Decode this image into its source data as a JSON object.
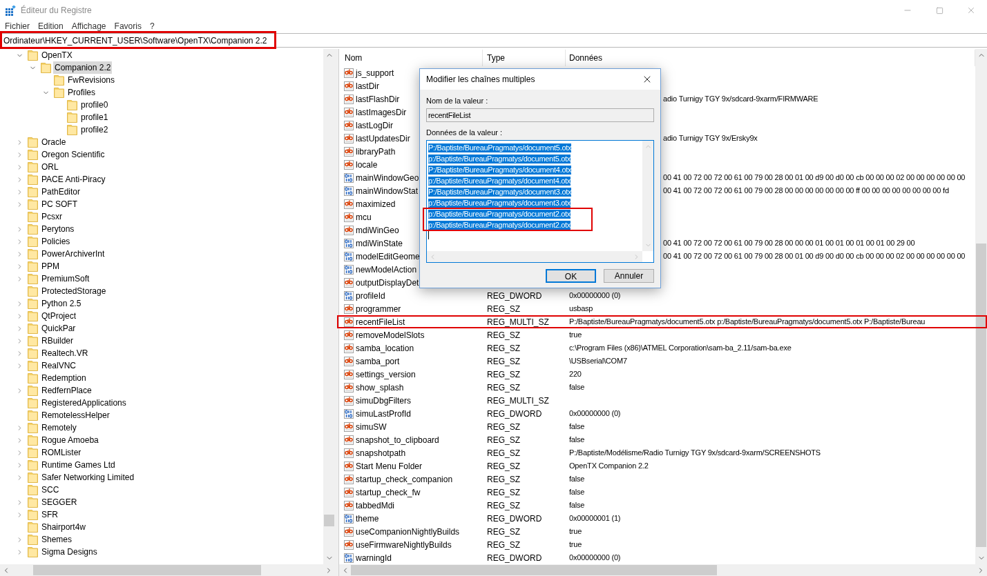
{
  "window": {
    "title": "Éditeur du Registre"
  },
  "menu": [
    "Fichier",
    "Edition",
    "Affichage",
    "Favoris",
    "?"
  ],
  "address_bar": {
    "value": "Ordinateur\\HKEY_CURRENT_USER\\Software\\OpenTX\\Companion 2.2"
  },
  "tree": [
    {
      "name": "OpenTX",
      "expanded": true,
      "selected": false,
      "children": [
        {
          "name": "Companion 2.2",
          "expanded": true,
          "selected": true,
          "children": [
            {
              "name": "FwRevisions",
              "selected": false
            },
            {
              "name": "Profiles",
              "expanded": true,
              "selected": false,
              "children": [
                {
                  "name": "profile0",
                  "selected": false
                },
                {
                  "name": "profile1",
                  "selected": false
                },
                {
                  "name": "profile2",
                  "selected": false
                }
              ]
            }
          ]
        }
      ]
    },
    {
      "name": "Oracle",
      "expanded": false,
      "selected": false
    },
    {
      "name": "Oregon Scientific",
      "expanded": false,
      "selected": false
    },
    {
      "name": "ORL",
      "expanded": false,
      "selected": false
    },
    {
      "name": "PACE Anti-Piracy",
      "expanded": false,
      "selected": false
    },
    {
      "name": "PathEditor",
      "expanded": false,
      "selected": false
    },
    {
      "name": "PC SOFT",
      "expanded": false,
      "selected": false
    },
    {
      "name": "Pcsxr",
      "selected": false
    },
    {
      "name": "Perytons",
      "expanded": false,
      "selected": false
    },
    {
      "name": "Policies",
      "expanded": false,
      "selected": false
    },
    {
      "name": "PowerArchiverInt",
      "expanded": false,
      "selected": false
    },
    {
      "name": "PPM",
      "expanded": false,
      "selected": false
    },
    {
      "name": "PremiumSoft",
      "expanded": false,
      "selected": false
    },
    {
      "name": "ProtectedStorage",
      "selected": false
    },
    {
      "name": "Python 2.5",
      "expanded": false,
      "selected": false
    },
    {
      "name": "QtProject",
      "expanded": false,
      "selected": false
    },
    {
      "name": "QuickPar",
      "expanded": false,
      "selected": false
    },
    {
      "name": "RBuilder",
      "expanded": false,
      "selected": false
    },
    {
      "name": "Realtech.VR",
      "expanded": false,
      "selected": false
    },
    {
      "name": "RealVNC",
      "expanded": false,
      "selected": false
    },
    {
      "name": "Redemption",
      "selected": false
    },
    {
      "name": "RedfernPlace",
      "expanded": false,
      "selected": false
    },
    {
      "name": "RegisteredApplications",
      "selected": false
    },
    {
      "name": "RemotelessHelper",
      "selected": false
    },
    {
      "name": "Remotely",
      "expanded": false,
      "selected": false
    },
    {
      "name": "Rogue Amoeba",
      "expanded": false,
      "selected": false
    },
    {
      "name": "ROMLister",
      "expanded": false,
      "selected": false
    },
    {
      "name": "Runtime Games Ltd",
      "expanded": false,
      "selected": false
    },
    {
      "name": "Safer Networking Limited",
      "expanded": false,
      "selected": false
    },
    {
      "name": "SCC",
      "selected": false
    },
    {
      "name": "SEGGER",
      "expanded": false,
      "selected": false
    },
    {
      "name": "SFR",
      "expanded": false,
      "selected": false
    },
    {
      "name": "Shairport4w",
      "selected": false
    },
    {
      "name": "Shemes",
      "expanded": false,
      "selected": false
    },
    {
      "name": "Sigma Designs",
      "expanded": false,
      "selected": false
    }
  ],
  "list": {
    "columns": [
      "Nom",
      "Type",
      "Données"
    ],
    "rows": [
      {
        "kind": "string",
        "name": "js_support"
      },
      {
        "kind": "string",
        "name": "lastDir"
      },
      {
        "kind": "string",
        "name": "lastFlashDir",
        "data": "adio Turnigy TGY 9x/sdcard-9xarm/FIRMWARE"
      },
      {
        "kind": "string",
        "name": "lastImagesDir"
      },
      {
        "kind": "string",
        "name": "lastLogDir"
      },
      {
        "kind": "string",
        "name": "lastUpdatesDir",
        "data": "adio Turnigy TGY 9x/Ersky9x"
      },
      {
        "kind": "string",
        "name": "libraryPath"
      },
      {
        "kind": "string",
        "name": "locale"
      },
      {
        "kind": "binary",
        "name": "mainWindowGeo",
        "data": "00 41 00 72 00 72 00 61 00 79 00 28 00 01 00 d9 00 d0 00 cb 00 00 00 02 00 00 00 00 00 00"
      },
      {
        "kind": "binary",
        "name": "mainWindowStat",
        "data": "00 41 00 72 00 72 00 61 00 79 00 28 00 00 00 00 00 00 00 ff 00 00 00 00 00 00 00 00 fd"
      },
      {
        "kind": "string",
        "name": "maximized"
      },
      {
        "kind": "string",
        "name": "mcu"
      },
      {
        "kind": "string",
        "name": "mdiWinGeo"
      },
      {
        "kind": "binary",
        "name": "mdiWinState",
        "data": "00 41 00 72 00 72 00 61 00 79 00 28 00 00 00 01 00 01 00 01 00 01 00 29 00"
      },
      {
        "kind": "binary",
        "name": "modelEditGeome",
        "data": "00 41 00 72 00 72 00 61 00 79 00 28 00 01 00 d9 00 d0 00 cb 00 00 00 02 00 00 00 00 00 00"
      },
      {
        "kind": "binary",
        "name": "newModelAction"
      },
      {
        "kind": "string",
        "name": "outputDisplayDet"
      },
      {
        "kind": "binary",
        "name": "profileId",
        "type": "REG_DWORD",
        "data": "0x00000000 (0)"
      },
      {
        "kind": "string",
        "name": "programmer",
        "type": "REG_SZ",
        "data": "usbasp"
      },
      {
        "kind": "string",
        "name": "recentFileList",
        "type": "REG_MULTI_SZ",
        "data": "P:/Baptiste/BureauPragmatys/document5.otx p:/Baptiste/BureauPragmatys/document5.otx P:/Baptiste/Bureau"
      },
      {
        "kind": "string",
        "name": "removeModelSlots",
        "type": "REG_SZ",
        "data": "true"
      },
      {
        "kind": "string",
        "name": "samba_location",
        "type": "REG_SZ",
        "data": "c:\\Program Files (x86)\\ATMEL Corporation\\sam-ba_2.11/sam-ba.exe"
      },
      {
        "kind": "string",
        "name": "samba_port",
        "type": "REG_SZ",
        "data": "\\USBserial\\COM7"
      },
      {
        "kind": "string",
        "name": "settings_version",
        "type": "REG_SZ",
        "data": "220"
      },
      {
        "kind": "string",
        "name": "show_splash",
        "type": "REG_SZ",
        "data": "false"
      },
      {
        "kind": "string",
        "name": "simuDbgFilters",
        "type": "REG_MULTI_SZ"
      },
      {
        "kind": "binary",
        "name": "simuLastProfId",
        "type": "REG_DWORD",
        "data": "0x00000000 (0)"
      },
      {
        "kind": "string",
        "name": "simuSW",
        "type": "REG_SZ",
        "data": "false"
      },
      {
        "kind": "string",
        "name": "snapshot_to_clipboard",
        "type": "REG_SZ",
        "data": "false"
      },
      {
        "kind": "string",
        "name": "snapshotpath",
        "type": "REG_SZ",
        "data": "P:/Baptiste/Modélisme/Radio Turnigy TGY 9x/sdcard-9xarm/SCREENSHOTS"
      },
      {
        "kind": "string",
        "name": "Start Menu Folder",
        "type": "REG_SZ",
        "data": "OpenTX Companion 2.2"
      },
      {
        "kind": "string",
        "name": "startup_check_companion",
        "type": "REG_SZ",
        "data": "false"
      },
      {
        "kind": "string",
        "name": "startup_check_fw",
        "type": "REG_SZ",
        "data": "false"
      },
      {
        "kind": "string",
        "name": "tabbedMdi",
        "type": "REG_SZ",
        "data": "false"
      },
      {
        "kind": "binary",
        "name": "theme",
        "type": "REG_DWORD",
        "data": "0x00000001 (1)"
      },
      {
        "kind": "string",
        "name": "useCompanionNightlyBuilds",
        "type": "REG_SZ",
        "data": "true"
      },
      {
        "kind": "string",
        "name": "useFirmwareNightlyBuilds",
        "type": "REG_SZ",
        "data": "true"
      },
      {
        "kind": "binary",
        "name": "warningId",
        "type": "REG_DWORD",
        "data": "0x00000000 (0)"
      }
    ]
  },
  "dialog": {
    "title": "Modifier les chaînes multiples",
    "name_label": "Nom de la valeur :",
    "name_value": "recentFileList",
    "data_label": "Données de la valeur :",
    "data_lines": [
      {
        "text": "P:/Baptiste/BureauPragmatys/document5.otx",
        "selected": true
      },
      {
        "text": "p:/Baptiste/BureauPragmatys/document5.otx",
        "selected": true
      },
      {
        "text": "P:/Baptiste/BureauPragmatys/document4.otx",
        "selected": true
      },
      {
        "text": "p:/Baptiste/BureauPragmatys/document4.otx",
        "selected": true
      },
      {
        "text": "P:/Baptiste/BureauPragmatys/document3.otx",
        "selected": true
      },
      {
        "text": "p:/Baptiste/BureauPragmatys/document3.otx",
        "selected": true
      },
      {
        "text": "p:/Baptiste/BureauPragmatys/document2.otx",
        "selected": true
      },
      {
        "text": "p:/Baptiste/BureauPragmatys/document2.otx",
        "selected": true
      }
    ],
    "buttons": [
      {
        "label": "OK",
        "default": true
      },
      {
        "label": "Annuler",
        "default": false
      }
    ]
  }
}
